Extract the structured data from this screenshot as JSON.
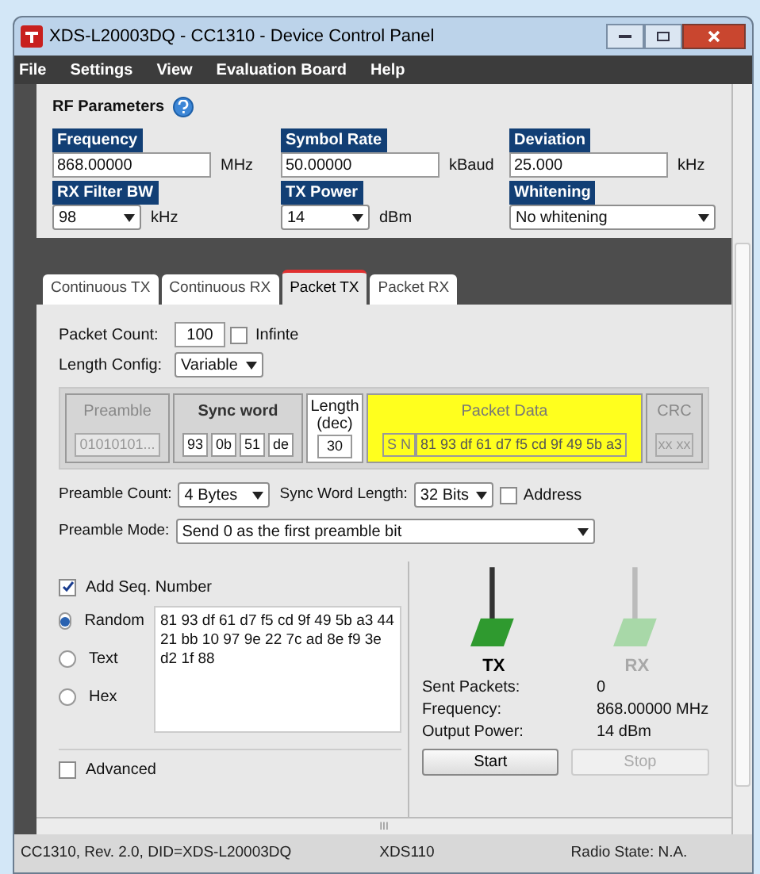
{
  "window": {
    "title": "XDS-L20003DQ - CC1310 - Device Control Panel"
  },
  "menu": [
    "File",
    "Settings",
    "View",
    "Evaluation Board",
    "Help"
  ],
  "rf_parameters": {
    "title": "RF Parameters",
    "fields": [
      {
        "label": "Frequency",
        "kind": "input",
        "value": "868.00000",
        "unit": "MHz"
      },
      {
        "label": "Symbol Rate",
        "kind": "input",
        "value": "50.00000",
        "unit": "kBaud"
      },
      {
        "label": "Deviation",
        "kind": "input",
        "value": "25.000",
        "unit": "kHz"
      },
      {
        "label": "RX Filter BW",
        "kind": "select",
        "value": "98",
        "unit": "kHz"
      },
      {
        "label": "TX Power",
        "kind": "select",
        "value": "14",
        "unit": "dBm"
      },
      {
        "label": "Whitening",
        "kind": "wide-select",
        "value": "No whitening"
      }
    ]
  },
  "tabs": [
    {
      "label": "Continuous TX",
      "selected": false
    },
    {
      "label": "Continuous RX",
      "selected": false
    },
    {
      "label": "Packet TX",
      "selected": true
    },
    {
      "label": "Packet RX",
      "selected": false
    }
  ],
  "packet_count": {
    "label": "Packet Count:",
    "value": "100",
    "infinite": {
      "label": "Infinte",
      "checked": false
    }
  },
  "length_config": {
    "label": "Length Config:",
    "value": "Variable"
  },
  "packet_structure": {
    "preamble": {
      "title": "Preamble",
      "value": "01010101...",
      "disabled": true
    },
    "sync_word": {
      "title": "Sync word",
      "bytes": [
        "93",
        "0b",
        "51",
        "de"
      ]
    },
    "length": {
      "title": "Length (dec)",
      "value": "30"
    },
    "packet_data": {
      "title": "Packet Data",
      "seq": "S N",
      "value": "81 93 df 61 d7 f5 cd 9f 49 5b a3"
    },
    "crc": {
      "title": "CRC",
      "value": "xx xx",
      "disabled": true
    }
  },
  "preamble_count": {
    "label": "Preamble Count:",
    "value": "4 Bytes"
  },
  "sync_word_length": {
    "label": "Sync Word Length:",
    "value": "32 Bits"
  },
  "address": {
    "label": "Address",
    "checked": false
  },
  "preamble_mode": {
    "label": "Preamble Mode:",
    "value": "Send 0 as the first preamble bit"
  },
  "add_seq_number": {
    "label": "Add Seq. Number",
    "checked": true
  },
  "payload_modes": [
    {
      "label": "Random",
      "selected": true
    },
    {
      "label": "Text",
      "selected": false
    },
    {
      "label": "Hex",
      "selected": false
    }
  ],
  "payload": "81 93 df 61 d7 f5 cd 9f 49 5b a3 44 21 bb 10 97 9e 22 7c ad 8e f9 3e d2 1f 88",
  "advanced": {
    "label": "Advanced",
    "checked": false
  },
  "antennas": [
    {
      "label": "TX",
      "active": true
    },
    {
      "label": "RX",
      "active": false
    }
  ],
  "stats": [
    {
      "label": "Sent Packets:",
      "value": "0"
    },
    {
      "label": "Frequency:",
      "value": "868.00000 MHz"
    },
    {
      "label": "Output Power:",
      "value": "14 dBm"
    }
  ],
  "buttons": [
    {
      "label": "Start",
      "disabled": false
    },
    {
      "label": "Stop",
      "disabled": true
    }
  ],
  "scrollbar_grip": "III",
  "status_bar": [
    "CC1310, Rev. 2.0, DID=XDS-L20003DQ",
    "XDS110",
    "Radio State: N.A."
  ]
}
